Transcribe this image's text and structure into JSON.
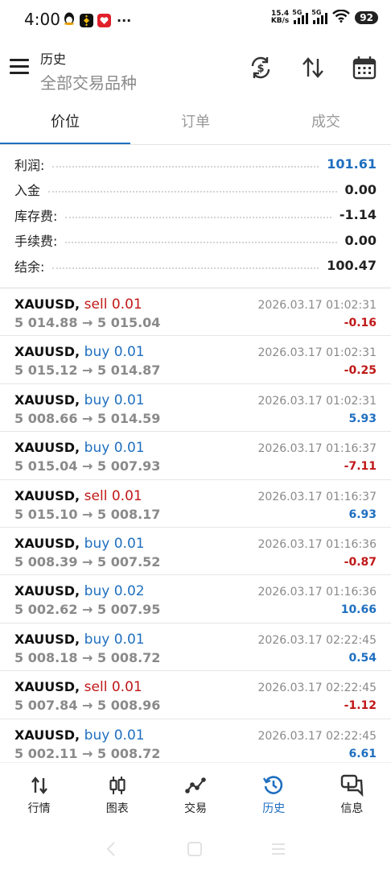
{
  "status_bar": {
    "time": "4:00",
    "net_speed_value": "15.4",
    "net_speed_unit": "KB/s",
    "signal1_label": "5G",
    "signal2_label": "5G",
    "battery": "92",
    "more": "···"
  },
  "header": {
    "title": "历史",
    "subtitle": "全部交易品种"
  },
  "tabs": [
    {
      "label": "价位",
      "active": true
    },
    {
      "label": "订单",
      "active": false
    },
    {
      "label": "成交",
      "active": false
    }
  ],
  "summary": [
    {
      "label": "利润:",
      "value": "101.61",
      "highlight": true
    },
    {
      "label": "入金",
      "value": "0.00",
      "highlight": false
    },
    {
      "label": "库存费:",
      "value": "-1.14",
      "highlight": false
    },
    {
      "label": "手续费:",
      "value": "0.00",
      "highlight": false
    },
    {
      "label": "结余:",
      "value": "100.47",
      "highlight": false
    }
  ],
  "deals": [
    {
      "symbol": "XAUUSD,",
      "side": "sell",
      "volume": "0.01",
      "prices": "5 014.88 → 5 015.04",
      "time": "2026.03.17 01:02:31",
      "profit": "-0.16",
      "profit_sign": "neg"
    },
    {
      "symbol": "XAUUSD,",
      "side": "buy",
      "volume": "0.01",
      "prices": "5 015.12 → 5 014.87",
      "time": "2026.03.17 01:02:31",
      "profit": "-0.25",
      "profit_sign": "neg"
    },
    {
      "symbol": "XAUUSD,",
      "side": "buy",
      "volume": "0.01",
      "prices": "5 008.66 → 5 014.59",
      "time": "2026.03.17 01:02:31",
      "profit": "5.93",
      "profit_sign": "pos"
    },
    {
      "symbol": "XAUUSD,",
      "side": "buy",
      "volume": "0.01",
      "prices": "5 015.04 → 5 007.93",
      "time": "2026.03.17 01:16:37",
      "profit": "-7.11",
      "profit_sign": "neg"
    },
    {
      "symbol": "XAUUSD,",
      "side": "sell",
      "volume": "0.01",
      "prices": "5 015.10 → 5 008.17",
      "time": "2026.03.17 01:16:37",
      "profit": "6.93",
      "profit_sign": "pos"
    },
    {
      "symbol": "XAUUSD,",
      "side": "buy",
      "volume": "0.01",
      "prices": "5 008.39 → 5 007.52",
      "time": "2026.03.17 01:16:36",
      "profit": "-0.87",
      "profit_sign": "neg"
    },
    {
      "symbol": "XAUUSD,",
      "side": "buy",
      "volume": "0.02",
      "prices": "5 002.62 → 5 007.95",
      "time": "2026.03.17 01:16:36",
      "profit": "10.66",
      "profit_sign": "pos"
    },
    {
      "symbol": "XAUUSD,",
      "side": "buy",
      "volume": "0.01",
      "prices": "5 008.18 → 5 008.72",
      "time": "2026.03.17 02:22:45",
      "profit": "0.54",
      "profit_sign": "pos"
    },
    {
      "symbol": "XAUUSD,",
      "side": "sell",
      "volume": "0.01",
      "prices": "5 007.84 → 5 008.96",
      "time": "2026.03.17 02:22:45",
      "profit": "-1.12",
      "profit_sign": "neg"
    },
    {
      "symbol": "XAUUSD,",
      "side": "buy",
      "volume": "0.01",
      "prices": "5 002.11 → 5 008.72",
      "time": "2026.03.17 02:22:45",
      "profit": "6.61",
      "profit_sign": "pos"
    }
  ],
  "bottom_nav": [
    {
      "label": "行情",
      "icon": "quotes-icon",
      "active": false
    },
    {
      "label": "图表",
      "icon": "candlestick-chart-icon",
      "active": false
    },
    {
      "label": "交易",
      "icon": "trade-line-icon",
      "active": false
    },
    {
      "label": "历史",
      "icon": "history-clock-icon",
      "active": true
    },
    {
      "label": "信息",
      "icon": "messages-icon",
      "active": false
    }
  ],
  "colors": {
    "accent": "#1f6fc0",
    "sell": "#c01818",
    "muted": "#8a8a8a"
  }
}
